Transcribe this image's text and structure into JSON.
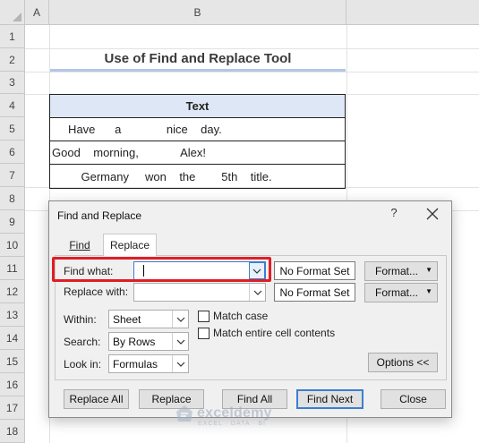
{
  "sheet": {
    "columns": [
      "A",
      "B"
    ],
    "rows": [
      "1",
      "2",
      "3",
      "4",
      "5",
      "6",
      "7",
      "8",
      "9",
      "10",
      "11",
      "12",
      "13",
      "14",
      "15",
      "16",
      "17",
      "18"
    ],
    "title": "Use of Find and Replace Tool",
    "table_header": "Text",
    "table_rows": [
      "     Have      a              nice    day.",
      "Good    morning,             Alex!",
      "         Germany     won    the        5th    title."
    ]
  },
  "dialog": {
    "title": "Find and Replace",
    "help": "?",
    "tabs": [
      "Find",
      "Replace"
    ],
    "active_tab": "Replace",
    "find_label": "Find what:",
    "find_value": "",
    "replace_label": "Replace with:",
    "replace_value": "",
    "no_format_set": "No Format Set",
    "format_button": "Format...",
    "within_label": "Within:",
    "within_value": "Sheet",
    "search_label": "Search:",
    "search_value": "By Rows",
    "lookin_label": "Look in:",
    "lookin_value": "Formulas",
    "match_case_label": "Match case",
    "match_case_checked": false,
    "match_entire_label": "Match entire cell contents",
    "match_entire_checked": false,
    "options_button": "Options <<",
    "buttons": {
      "replace_all": "Replace All",
      "replace": "Replace",
      "find_all": "Find All",
      "find_next": "Find Next",
      "close": "Close"
    }
  },
  "watermark": {
    "name": "exceldemy",
    "tagline": "EXCEL · DATA · BI"
  },
  "colors": {
    "highlight": "#e01e26",
    "focus_blue": "#3c7fd0",
    "table_header_bg": "#dde7f5",
    "title_underline": "#b4c6e7"
  }
}
